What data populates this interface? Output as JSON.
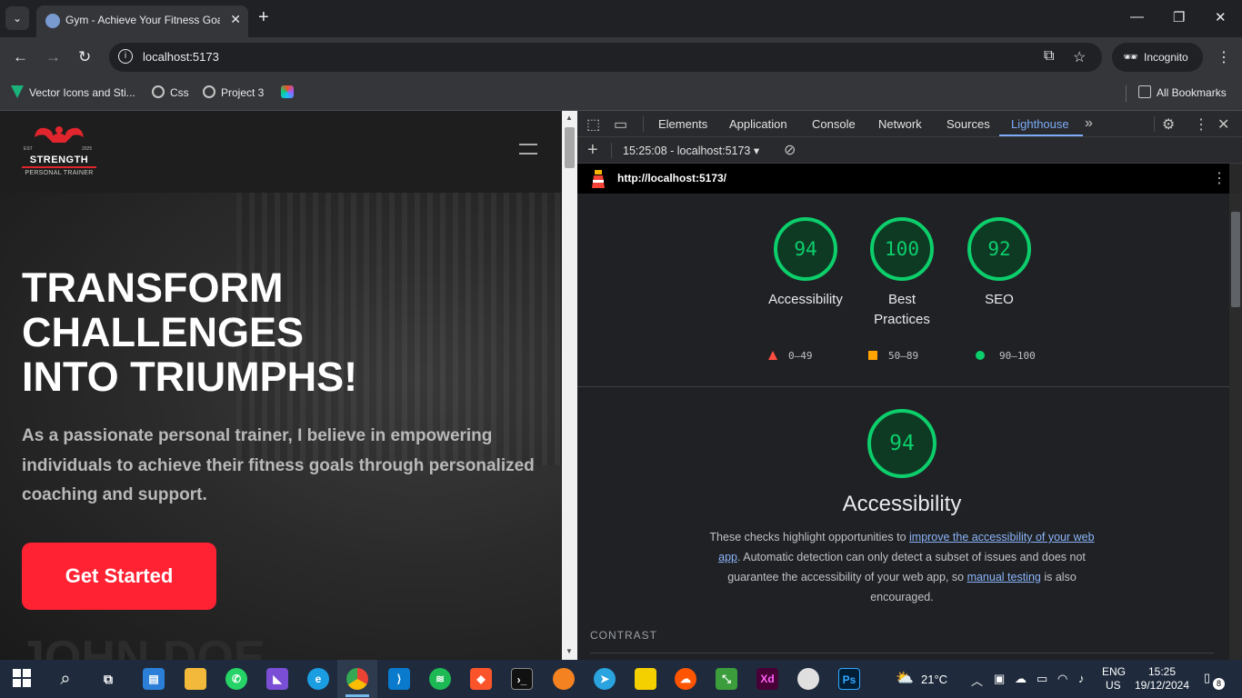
{
  "browser": {
    "tab_title": "Gym - Achieve Your Fitness Goa",
    "tab_close": "✕",
    "new_tab": "+",
    "url": "localhost:5173",
    "profile": "Incognito",
    "window_controls": {
      "minimize": "—",
      "restore": "❐",
      "close": "✕"
    },
    "bookmarks": [
      {
        "label": "Vector Icons and Sti..."
      },
      {
        "label": "Css"
      },
      {
        "label": "Project 3"
      }
    ],
    "all_bookmarks": "All Bookmarks"
  },
  "site": {
    "logo": {
      "est": "EST",
      "year": "2025",
      "brand": "STRENGTH",
      "tagline": "PERSONAL TRAINER"
    },
    "hero_title": [
      "TRANSFORM",
      "CHALLENGES",
      "INTO TRIUMPHS!"
    ],
    "hero_text": "As a passionate personal trainer, I believe in empowering individuals to achieve their fitness goals through personalized coaching and support.",
    "cta": "Get Started",
    "ghost_text": "JOHN DOE"
  },
  "devtools": {
    "tabs": [
      "Elements",
      "Application",
      "Console",
      "Network",
      "Sources",
      "Lighthouse"
    ],
    "active_tab": "Lighthouse",
    "report_selector": "15:25:08 - localhost:5173",
    "report_url": "http://localhost:5173/",
    "scores": [
      {
        "label": "Accessibility",
        "value": 94
      },
      {
        "label": "Best Practices",
        "value": 100
      },
      {
        "label": "SEO",
        "value": 92
      }
    ],
    "legend": {
      "fail": "0–49",
      "average": "50–89",
      "pass": "90–100"
    },
    "colors": {
      "pass": "#0cce6b",
      "average": "#ffa400",
      "fail": "#ff4e42"
    },
    "category": {
      "score": 94,
      "title": "Accessibility",
      "desc_1": "These checks highlight opportunities to ",
      "link_1": "improve the accessibility of your web app",
      "desc_2": ". Automatic detection can only detect a subset of issues and does not guarantee the accessibility of your web app, so ",
      "link_2": "manual testing",
      "desc_3": " is also encouraged."
    },
    "section_label": "CONTRAST"
  },
  "taskbar": {
    "weather": "21°C",
    "lang_1": "ENG",
    "lang_2": "US",
    "time": "15:25",
    "date": "19/12/2024",
    "notifications": "8"
  }
}
